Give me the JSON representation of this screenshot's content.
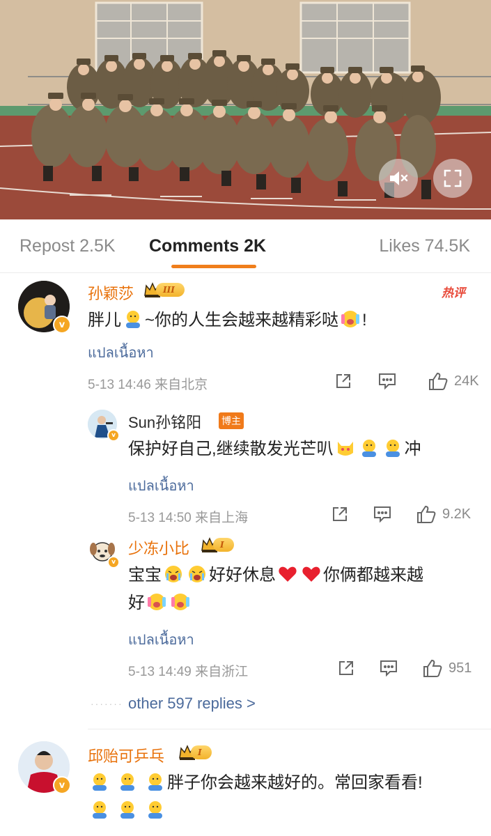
{
  "tabs": [
    {
      "label": "Repost 2.5K"
    },
    {
      "label": "Comments 2K"
    },
    {
      "label": "Likes 74.5K"
    }
  ],
  "comments": [
    {
      "name": "孙颖莎",
      "level": "III",
      "hot_label": "热评",
      "text_before": "胖儿",
      "text_mid": "~你的人生会越来越精彩哒",
      "text_after": "!",
      "translate": "แปลเนื้อหา",
      "meta": "5-13 14:46  来自北京",
      "likes": "24K",
      "replies": [
        {
          "name": "Sun孙铭阳",
          "badge": "博主",
          "text_before": "保护好自己,继续散发光芒叭",
          "text_after": "冲",
          "translate": "แปลเนื้อหา",
          "meta": "5-13 14:50  来自上海",
          "likes": "9.2K"
        },
        {
          "name": "少冻小比",
          "level": "I",
          "text_a": "宝宝",
          "text_b": "好好休息",
          "text_c": "你俩都越来越",
          "text_d": "好",
          "translate": "แปลเนื้อหา",
          "meta": "5-13 14:49  来自浙江",
          "likes": "951"
        }
      ],
      "more_replies": "other 597 replies >"
    },
    {
      "name": "邱贻可乒乓",
      "level": "I",
      "text": "胖子你会越来越好的。常回家看看!"
    }
  ],
  "colors": {
    "accent": "#f07e1b",
    "name": "#e8710a",
    "link": "#4b6a9b"
  },
  "icons": [
    "mute-icon",
    "fullscreen-icon",
    "share-icon",
    "comment-icon",
    "like-icon",
    "crown-icon",
    "verified-icon"
  ]
}
